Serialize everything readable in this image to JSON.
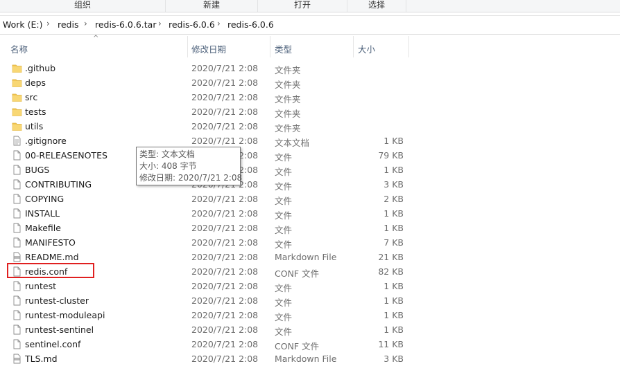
{
  "toolbar": {
    "groups": [
      {
        "label": "组织"
      },
      {
        "label": "新建"
      },
      {
        "label": "打开"
      },
      {
        "label": "选择"
      }
    ]
  },
  "breadcrumb": [
    "Work (E:)",
    "redis",
    "redis-6.0.6.tar",
    "redis-6.0.6",
    "redis-6.0.6"
  ],
  "columns": {
    "name": "名称",
    "modified": "修改日期",
    "type": "类型",
    "size": "大小"
  },
  "files": [
    {
      "icon": "folder-icon",
      "name": ".github",
      "modified": "2020/7/21 2:08",
      "type": "文件夹",
      "size": ""
    },
    {
      "icon": "folder-icon",
      "name": "deps",
      "modified": "2020/7/21 2:08",
      "type": "文件夹",
      "size": ""
    },
    {
      "icon": "folder-icon",
      "name": "src",
      "modified": "2020/7/21 2:08",
      "type": "文件夹",
      "size": ""
    },
    {
      "icon": "folder-icon",
      "name": "tests",
      "modified": "2020/7/21 2:08",
      "type": "文件夹",
      "size": ""
    },
    {
      "icon": "folder-icon",
      "name": "utils",
      "modified": "2020/7/21 2:08",
      "type": "文件夹",
      "size": ""
    },
    {
      "icon": "text-file-icon",
      "name": ".gitignore",
      "modified": "2020/7/21 2:08",
      "type": "文本文档",
      "size": "1 KB"
    },
    {
      "icon": "file-icon",
      "name": "00-RELEASENOTES",
      "modified": "2020/7/21 2:08",
      "type": "文件",
      "size": "79 KB"
    },
    {
      "icon": "file-icon",
      "name": "BUGS",
      "modified": "2020/7/21 2:08",
      "type": "文件",
      "size": "1 KB"
    },
    {
      "icon": "file-icon",
      "name": "CONTRIBUTING",
      "modified": "2020/7/21 2:08",
      "type": "文件",
      "size": "3 KB"
    },
    {
      "icon": "file-icon",
      "name": "COPYING",
      "modified": "2020/7/21 2:08",
      "type": "文件",
      "size": "2 KB"
    },
    {
      "icon": "file-icon",
      "name": "INSTALL",
      "modified": "2020/7/21 2:08",
      "type": "文件",
      "size": "1 KB"
    },
    {
      "icon": "file-icon",
      "name": "Makefile",
      "modified": "2020/7/21 2:08",
      "type": "文件",
      "size": "1 KB"
    },
    {
      "icon": "file-icon",
      "name": "MANIFESTO",
      "modified": "2020/7/21 2:08",
      "type": "文件",
      "size": "7 KB"
    },
    {
      "icon": "markdown-file-icon",
      "name": "README.md",
      "modified": "2020/7/21 2:08",
      "type": "Markdown File",
      "size": "21 KB"
    },
    {
      "icon": "file-icon",
      "name": "redis.conf",
      "modified": "2020/7/21 2:08",
      "type": "CONF 文件",
      "size": "82 KB"
    },
    {
      "icon": "file-icon",
      "name": "runtest",
      "modified": "2020/7/21 2:08",
      "type": "文件",
      "size": "1 KB"
    },
    {
      "icon": "file-icon",
      "name": "runtest-cluster",
      "modified": "2020/7/21 2:08",
      "type": "文件",
      "size": "1 KB"
    },
    {
      "icon": "file-icon",
      "name": "runtest-moduleapi",
      "modified": "2020/7/21 2:08",
      "type": "文件",
      "size": "1 KB"
    },
    {
      "icon": "file-icon",
      "name": "runtest-sentinel",
      "modified": "2020/7/21 2:08",
      "type": "文件",
      "size": "1 KB"
    },
    {
      "icon": "file-icon",
      "name": "sentinel.conf",
      "modified": "2020/7/21 2:08",
      "type": "CONF 文件",
      "size": "11 KB"
    },
    {
      "icon": "markdown-file-icon",
      "name": "TLS.md",
      "modified": "2020/7/21 2:08",
      "type": "Markdown File",
      "size": "3 KB"
    }
  ],
  "tooltip": {
    "lines": [
      "类型: 文本文档",
      "大小: 408 字节",
      "修改日期: 2020/7/21 2:08"
    ]
  },
  "colors": {
    "highlight_border": "#e02020",
    "folder": "#f2c755",
    "header_text": "#4c607a"
  }
}
